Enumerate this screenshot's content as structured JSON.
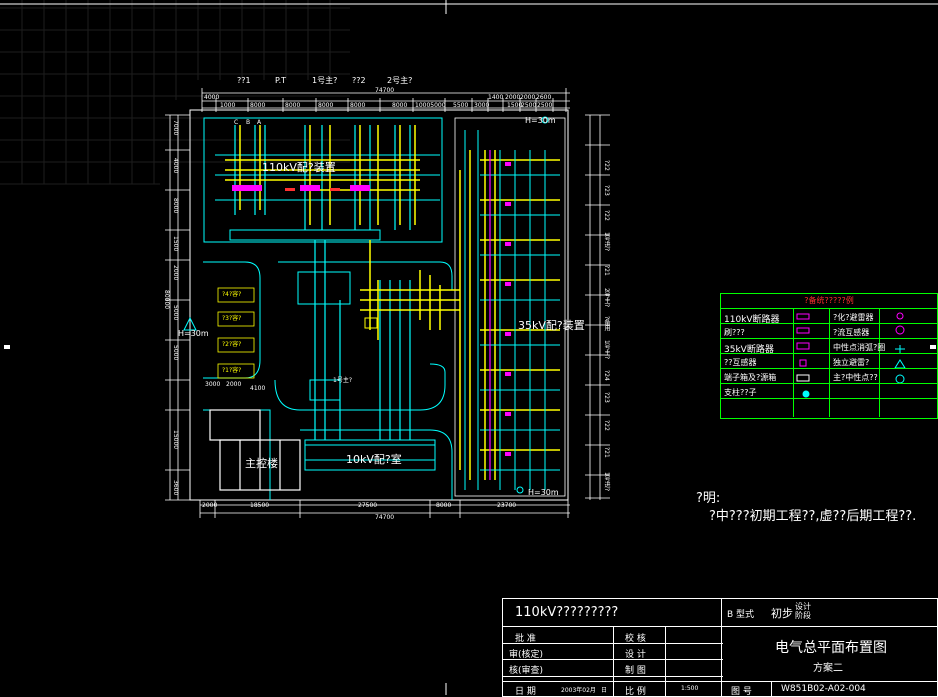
{
  "drawing": {
    "top_headers": [
      "??1",
      "P.T",
      "1号主?",
      "??2",
      "2号主?"
    ],
    "top_total": "74700",
    "top_dims": [
      "4000",
      "1000",
      "8000",
      "8000",
      "8000",
      "8000",
      "8000",
      "8000",
      "10005000",
      "5500",
      "3000",
      "1400",
      "2000",
      "2000",
      "2600",
      "1500",
      "2500",
      "2500"
    ],
    "label_110kv_zone": "110kV配?装置",
    "label_35kv_zone": "35kV配?装置",
    "label_10kv_room": "10kV配?室",
    "label_main_building": "主控楼",
    "label_h30_right_top": "H=30m",
    "label_h30_left": "H=30m",
    "label_h30_right_bottom": "H=30m",
    "label_1hao": "1号主?",
    "left_dims": [
      "7000",
      "4000",
      "8000",
      "1500",
      "2000",
      "5000",
      "5000",
      "2000",
      "15000",
      "3600",
      "80000"
    ],
    "bottom_dims": [
      "2000",
      "18500",
      "27500",
      "8000",
      "23700"
    ],
    "bottom_total": "74700",
    "mid_dims": [
      "3000",
      "2000",
      "4100",
      "5500",
      "2000"
    ],
    "right_bays": [
      "?22",
      "?23",
      "?22",
      "?21",
      "1号进?",
      "2号主?",
      "?备用",
      "1号主?",
      "?24",
      "?23",
      "?22",
      "?21",
      "1号进?"
    ],
    "right_dims": [
      "5000",
      "5000",
      "5000",
      "5000",
      "5000",
      "5000",
      "5000",
      "5000",
      "5000",
      "5000",
      "5000",
      "5000"
    ],
    "capacitor_labels": [
      "?4?容?",
      "?3?容?",
      "?2?容?",
      "?1?容?"
    ],
    "phase_labels": [
      "C",
      "B",
      "A"
    ]
  },
  "legend": {
    "title": "?备统?????例",
    "rows": [
      {
        "name": "110kV断路器",
        "name2": "?化?避雷器"
      },
      {
        "name": "刷???",
        "name2": "?流互感器"
      },
      {
        "name": "35kV断路器",
        "name2": "中性点消弧?圈"
      },
      {
        "name": "??互感器",
        "name2": "独立避雷?"
      },
      {
        "name": "端子箱及?源箱",
        "name2": "主?中性点??"
      },
      {
        "name": "支柱??子",
        "name2": ""
      }
    ]
  },
  "notes": {
    "title": "?明:",
    "body": "?中???初期工程??,虚??后期工程??."
  },
  "title_block": {
    "project": "110kV?????????",
    "stage_type": "B 型式",
    "stage": "初步",
    "stage_sub": "设计\n阶段",
    "drawing_title": "电气总平面布置图",
    "scheme": "方案二",
    "roles_left": [
      "批 准",
      "审(核定)",
      "核(审查)",
      "日 期"
    ],
    "roles_mid": [
      "校 核",
      "设 计",
      "制 图",
      "比 例"
    ],
    "date": "2003年02月",
    "date_suffix": "日",
    "scale": "1:500",
    "drawing_no_label": "图 号",
    "drawing_no": "W851B02-A02-004"
  },
  "colors": {
    "background": "#000000",
    "cyan": "#00ffff",
    "yellow": "#ffff00",
    "green": "#00ff00",
    "magenta": "#ff00ff",
    "red": "#ff2a2a",
    "white": "#ffffff"
  }
}
